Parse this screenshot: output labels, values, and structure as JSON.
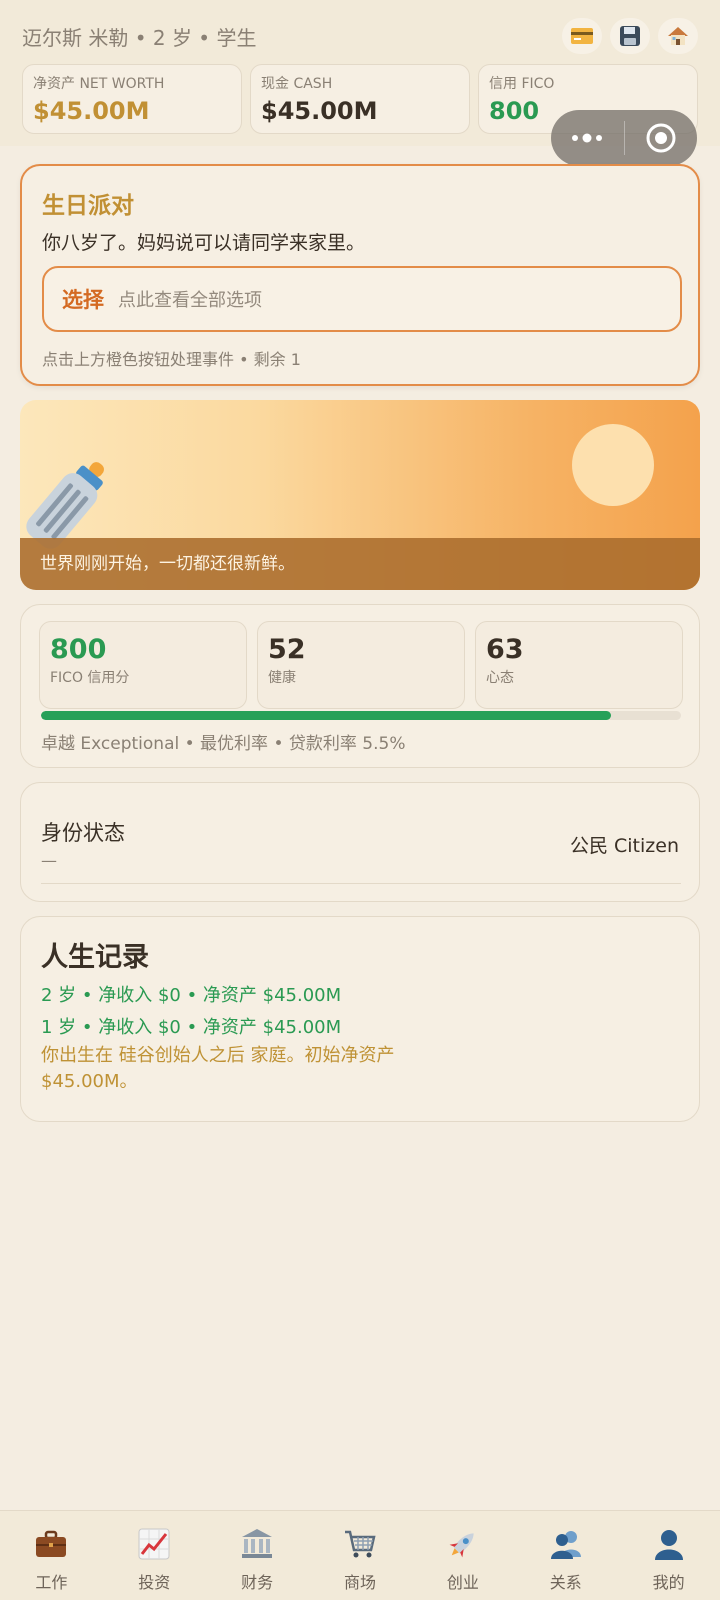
{
  "header": {
    "profile_line": "迈尔斯 米勒 • 2 岁 • 学生",
    "icons": [
      "credit-card-icon",
      "save-icon",
      "house-icon"
    ],
    "stats": [
      {
        "label": "净资产 NET WORTH",
        "value": "$45.00M",
        "color": "#c19034"
      },
      {
        "label": "现金 CASH",
        "value": "$45.00M",
        "color": "#3a3026"
      },
      {
        "label": "信用 FICO",
        "value": "800",
        "color": "#2a9a52"
      }
    ]
  },
  "event": {
    "title": "生日派对",
    "description": "你八岁了。妈妈说可以请同学来家里。",
    "choice_label": "选择",
    "choice_hint": "点此查看全部选项",
    "footer": "点击上方橙色按钮处理事件 • 剩余 1"
  },
  "banner": {
    "caption": "世界刚刚开始，一切都还很新鲜。",
    "icon": "baby-bottle-icon"
  },
  "stats_panel": {
    "items": [
      {
        "value": "800",
        "label": "FICO 信用分",
        "color": "#2a9a52"
      },
      {
        "value": "52",
        "label": "健康",
        "color": "#3a3026"
      },
      {
        "value": "63",
        "label": "心态",
        "color": "#3a3026"
      }
    ],
    "fico_progress": 0.89,
    "description": "卓越 Exceptional • 最优利率 • 贷款利率 5.5%"
  },
  "identity": {
    "title": "身份状态",
    "subtitle": "—",
    "value": "公民 Citizen"
  },
  "life_log": {
    "title": "人生记录",
    "entries": [
      "2 岁 • 净收入 $0 • 净资产 $45.00M",
      "1 岁 • 净收入 $0 • 净资产 $45.00M",
      "你出生在 硅谷创始人之后 家庭。初始净资产 $45.00M。"
    ]
  },
  "nav": [
    {
      "label": "工作",
      "icon": "briefcase-icon"
    },
    {
      "label": "投资",
      "icon": "chart-up-icon"
    },
    {
      "label": "财务",
      "icon": "bank-icon"
    },
    {
      "label": "商场",
      "icon": "shopping-cart-icon"
    },
    {
      "label": "创业",
      "icon": "rocket-icon"
    },
    {
      "label": "关系",
      "icon": "people-icon"
    },
    {
      "label": "我的",
      "icon": "user-icon"
    }
  ],
  "colors": {
    "accent_orange": "#e38c48",
    "gold": "#c19034",
    "green": "#2a9a52",
    "background": "#f4ede1"
  }
}
